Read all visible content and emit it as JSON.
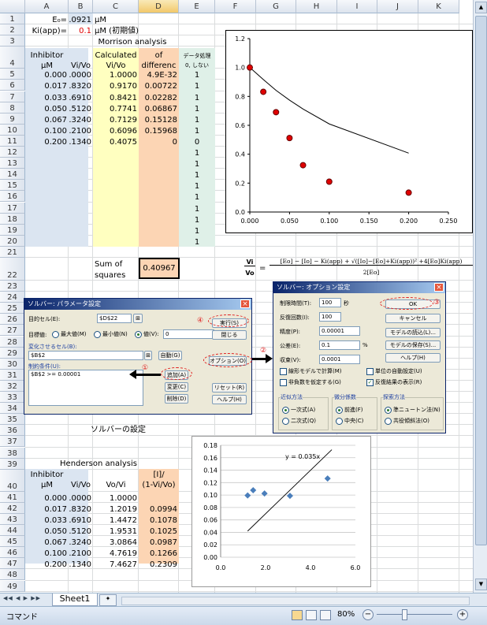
{
  "columns": [
    "A",
    "B",
    "C",
    "D",
    "E",
    "F",
    "G",
    "H",
    "I",
    "J",
    "K"
  ],
  "rows": [
    "1",
    "2",
    "3",
    "4",
    "5",
    "6",
    "7",
    "8",
    "9",
    "10",
    "11",
    "12",
    "13",
    "14",
    "15",
    "16",
    "17",
    "18",
    "19",
    "20",
    "21",
    "22",
    "23",
    "24",
    "25",
    "26",
    "27",
    "28",
    "29",
    "30",
    "31",
    "32",
    "33",
    "34",
    "35",
    "36",
    "37",
    "38",
    "39",
    "40",
    "41",
    "42",
    "43",
    "44",
    "45",
    "46",
    "47",
    "48",
    "49"
  ],
  "top": {
    "e0_label": "E₀=",
    "e0_value": "0.0921",
    "e0_unit": "μM",
    "ki_label": "Ki(app)=",
    "ki_value": "0.1",
    "ki_unit": "μM (初期値)",
    "morrison_title": "Morrison analysis",
    "h_inhibitor": "Inhibitor",
    "h_um": "μM",
    "h_vivo": "Vi/Vo",
    "h_calc1": "Calculated",
    "h_calc2": "Vi/Vo",
    "h_of": "of",
    "h_diff": "differenc",
    "h_data1": "データ処理",
    "h_data2": "0, しない"
  },
  "morrison_rows": [
    [
      "0.000",
      "1.0000",
      "1.0000",
      "4.9E-32",
      "1"
    ],
    [
      "0.017",
      "0.8320",
      "0.9170",
      "0.00722",
      "1"
    ],
    [
      "0.033",
      "0.6910",
      "0.8421",
      "0.02282",
      "1"
    ],
    [
      "0.050",
      "0.5120",
      "0.7741",
      "0.06867",
      "1"
    ],
    [
      "0.067",
      "0.3240",
      "0.7129",
      "0.15128",
      "1"
    ],
    [
      "0.100",
      "0.2100",
      "0.6096",
      "0.15968",
      "1"
    ],
    [
      "0.200",
      "0.1340",
      "0.4075",
      "0",
      "0"
    ]
  ],
  "ones": [
    "1",
    "1",
    "1",
    "1",
    "1",
    "1",
    "1",
    "1",
    "1"
  ],
  "sum": {
    "label1": "Sum of",
    "label2": "squares",
    "value": "0.40967"
  },
  "formula": {
    "lhs_num": "Vi",
    "lhs_den": "Vo",
    "eq": "=",
    "num": "[Eo] − [Io] − Ki(app) + √([Io]−[Eo]+Ki(app))² +4[Eo]Ki(app)",
    "den": "2[Eo]"
  },
  "solver_caption": "ソルバーの設定",
  "henderson": {
    "title": "Henderson analysis",
    "h_inhibitor": "Inhibitor",
    "h_um": "μM",
    "h_vivo": "Vi/Vo",
    "h_vovi": "Vo/Vi",
    "h_i1": "[I]/",
    "h_i2": "(1-Vi/Vo)",
    "rows": [
      [
        "0.000",
        "1.0000",
        "1.0000",
        ""
      ],
      [
        "0.017",
        "0.8320",
        "1.2019",
        "0.0994"
      ],
      [
        "0.033",
        "0.6910",
        "1.4472",
        "0.1078"
      ],
      [
        "0.050",
        "0.5120",
        "1.9531",
        "0.1025"
      ],
      [
        "0.067",
        "0.3240",
        "3.0864",
        "0.0987"
      ],
      [
        "0.100",
        "0.2100",
        "4.7619",
        "0.1266"
      ],
      [
        "0.200",
        "0.1340",
        "7.4627",
        "0.2309"
      ]
    ]
  },
  "dialog1": {
    "title": "ソルバー: パラメータ設定",
    "target_label": "目的セル(E):",
    "target_value": "$D$22",
    "goal_label": "目標値:",
    "opt_max": "最大値(M)",
    "opt_min": "最小値(N)",
    "opt_val": "値(V):",
    "val_value": "0",
    "vary_label": "変化させるセル(B):",
    "vary_value": "$B$2",
    "auto_btn": "自動(G)",
    "constraint_label": "制約条件(U):",
    "constraint_value": "$B$2 >= 0.00001",
    "add_btn": "追加(A)",
    "change_btn": "変更(C)",
    "delete_btn": "削除(D)",
    "run_btn": "実行(S)",
    "close_btn": "閉じる",
    "option_btn": "オプション(O)",
    "reset_btn": "リセット(R)",
    "help_btn": "ヘルプ(H)"
  },
  "dialog2": {
    "title": "ソルバー: オプション設定",
    "time_label": "制限時間(T):",
    "time_value": "100",
    "time_unit": "秒",
    "iter_label": "反復回数(I):",
    "iter_value": "100",
    "prec_label": "精度(P):",
    "prec_value": "0.00001",
    "tol_label": "公差(E):",
    "tol_value": "0.1",
    "tol_unit": "%",
    "conv_label": "収束(V):",
    "conv_value": "0.0001",
    "ok_btn": "OK",
    "cancel_btn": "キャンセル",
    "load_btn": "モデルの読込(L)...",
    "save_btn": "モデルの保存(S)...",
    "help_btn": "ヘルプ(H)",
    "chk_linear": "線形モデルで計算(M)",
    "chk_nonneg": "非負数を仮定する(G)",
    "chk_scale": "単位の自動設定(U)",
    "chk_show": "反復結果の表示(R)",
    "est_title": "近似方法",
    "est1": "一次式(A)",
    "est2": "二次式(Q)",
    "deriv_title": "微分係数",
    "deriv1": "前進(F)",
    "deriv2": "中央(C)",
    "search_title": "探索方法",
    "search1": "準ニュートン法(N)",
    "search2": "共役傾斜法(O)"
  },
  "marks": {
    "m1": "①",
    "m2": "②",
    "m3": "③",
    "m4": "④"
  },
  "chart1_ticks": {
    "y": [
      "1.2",
      "1.0",
      "0.8",
      "0.6",
      "0.4",
      "0.2",
      "0.0"
    ],
    "x": [
      "0.000",
      "0.050",
      "0.100",
      "0.150",
      "0.200",
      "0.250"
    ]
  },
  "chart2_ticks": {
    "y": [
      "0.18",
      "0.16",
      "0.14",
      "0.12",
      "0.10",
      "0.08",
      "0.06",
      "0.04",
      "0.02",
      "0.00"
    ],
    "x": [
      "0.0",
      "2.0",
      "4.0",
      "6.0"
    ],
    "eq": "y = 0.035x"
  },
  "chart_data": [
    {
      "type": "scatter",
      "title": "",
      "xlabel": "",
      "ylabel": "",
      "xlim": [
        0,
        0.25
      ],
      "ylim": [
        0,
        1.2
      ],
      "grid": false,
      "series": [
        {
          "values_x": [
            0,
            0.017,
            0.033,
            0.05,
            0.067,
            0.1,
            0.2
          ],
          "values_y": [
            1.0,
            0.832,
            0.691,
            0.512,
            0.324,
            0.21,
            0.134
          ]
        },
        {
          "values_x": [
            0,
            0.017,
            0.033,
            0.05,
            0.067,
            0.1,
            0.2
          ],
          "values_y": [
            1.0,
            0.917,
            0.8421,
            0.7741,
            0.7129,
            0.6096,
            0.4075
          ]
        }
      ]
    },
    {
      "type": "scatter",
      "title": "",
      "xlabel": "",
      "ylabel": "",
      "xlim": [
        0,
        6
      ],
      "ylim": [
        0,
        0.18
      ],
      "grid": true,
      "series": [
        {
          "values_x": [
            1.2019,
            1.4472,
            1.9531,
            3.0864,
            4.7619
          ],
          "values_y": [
            0.0994,
            0.1078,
            0.1025,
            0.0987,
            0.1266
          ]
        },
        {
          "values_x": [
            1.2019,
            1.4472,
            1.9531,
            3.0864,
            4.7619,
            7.4627
          ],
          "values_y": [
            0.042,
            0.0507,
            0.068,
            0.108,
            0.167,
            0.261
          ]
        }
      ],
      "annotation": "y = 0.035x"
    }
  ],
  "bottom": {
    "sheet_tab": "Sheet1",
    "status": "コマンド",
    "zoom": "80%",
    "nav": [
      "◀◀",
      "◀",
      "▶",
      "▶▶"
    ]
  }
}
